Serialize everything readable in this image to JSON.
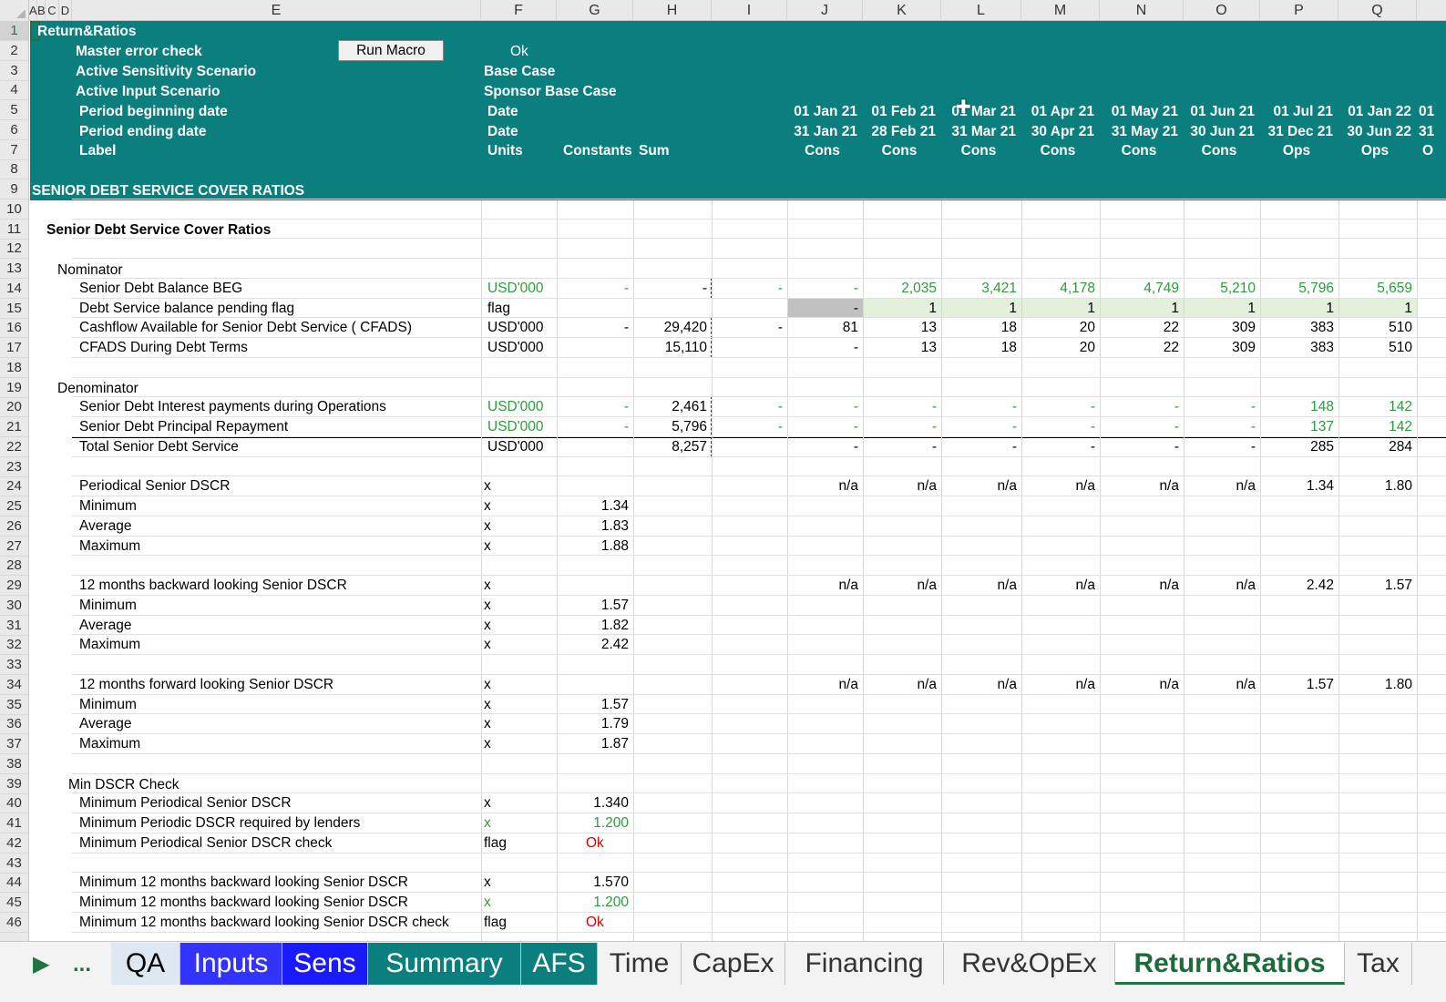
{
  "sheet": {
    "columns": [
      "A",
      "B",
      "C",
      "D",
      "E",
      "F",
      "G",
      "H",
      "I",
      "J",
      "K",
      "L",
      "M",
      "N",
      "O",
      "P",
      "Q"
    ],
    "rows": [
      "1",
      "2",
      "3",
      "4",
      "5",
      "6",
      "7",
      "8",
      "9",
      "10",
      "11",
      "12",
      "13",
      "14",
      "15",
      "16",
      "17",
      "18",
      "19",
      "20",
      "21",
      "22",
      "23",
      "24",
      "25",
      "26",
      "27",
      "28",
      "29",
      "30",
      "31",
      "32",
      "33",
      "34",
      "35",
      "36",
      "37",
      "38",
      "39",
      "40",
      "41",
      "42",
      "43",
      "44",
      "45",
      "46"
    ]
  },
  "header": {
    "title": "Return&Ratios",
    "master_error_check": "Master error check",
    "run_macro": "Run Macro",
    "ok_status": "Ok",
    "active_sensitivity": "Active Sensitivity Scenario",
    "active_sensitivity_value": "Base Case",
    "active_input": "Active Input Scenario",
    "active_input_value": "Sponsor Base Case",
    "period_beg": "Period beginning date",
    "period_end": "Period ending date",
    "label": "Label",
    "date1": "Date",
    "date2": "Date",
    "units": "Units",
    "constants": "Constants",
    "sum": "Sum",
    "section": "SENIOR DEBT SERVICE COVER RATIOS",
    "periods": [
      {
        "beg": "01 Jan 21",
        "end": "31 Jan 21",
        "phase": "Cons"
      },
      {
        "beg": "01 Feb 21",
        "end": "28 Feb 21",
        "phase": "Cons"
      },
      {
        "beg": "01 Mar 21",
        "end": "31 Mar 21",
        "phase": "Cons"
      },
      {
        "beg": "01 Apr 21",
        "end": "30 Apr 21",
        "phase": "Cons"
      },
      {
        "beg": "01 May 21",
        "end": "31 May 21",
        "phase": "Cons"
      },
      {
        "beg": "01 Jun 21",
        "end": "30 Jun 21",
        "phase": "Cons"
      },
      {
        "beg": "01 Jul 21",
        "end": "31 Dec 21",
        "phase": "Ops"
      },
      {
        "beg": "01 Jan 22",
        "end": "30 Jun 22",
        "phase": "Ops"
      }
    ],
    "period_overflow": {
      "beg": "01",
      "end": "31",
      "phase": "O"
    }
  },
  "body": {
    "title": "Senior Debt Service Cover Ratios",
    "nominator": "Nominator",
    "denominator": "Denominator",
    "rows": [
      {
        "label": "Senior Debt  Balance BEG",
        "unit": "USD'000",
        "unit_green": true,
        "g": "-",
        "g_green": true,
        "h": "-",
        "i": "-",
        "i_green": true,
        "vals": [
          "-",
          "2,035",
          "3,421",
          "4,178",
          "4,749",
          "5,210",
          "5,796",
          "5,659"
        ],
        "green": true
      },
      {
        "label": "Debt Service balance pending flag",
        "unit": "flag",
        "g": "",
        "h": "",
        "i": "",
        "vals": [
          "-",
          "1",
          "1",
          "1",
          "1",
          "1",
          "1",
          "1"
        ]
      },
      {
        "label": "Cashflow Available for Senior Debt Service ( CFADS)",
        "unit": "USD'000",
        "g": "-",
        "h": "29,420",
        "i": "-",
        "vals": [
          "81",
          "13",
          "18",
          "20",
          "22",
          "309",
          "383",
          "510"
        ]
      },
      {
        "label": "CFADS During Debt Terms",
        "unit": "USD'000",
        "g": "",
        "h": "15,110",
        "i": "",
        "vals": [
          "-",
          "13",
          "18",
          "20",
          "22",
          "309",
          "383",
          "510"
        ]
      },
      {
        "label": "Senior Debt  Interest payments during Operations",
        "unit": "USD'000",
        "unit_green": true,
        "g": "-",
        "g_green": true,
        "h": "2,461",
        "i": "-",
        "i_green": true,
        "vals": [
          "-",
          "-",
          "-",
          "-",
          "-",
          "-",
          "148",
          "142"
        ],
        "green": true
      },
      {
        "label": "Senior Debt  Principal Repayment",
        "unit": "USD'000",
        "unit_green": true,
        "g": "-",
        "g_green": true,
        "h": "5,796",
        "i": "-",
        "i_green": true,
        "vals": [
          "-",
          "-",
          "-",
          "-",
          "-",
          "-",
          "137",
          "142"
        ],
        "green": true
      },
      {
        "label": "Total Senior Debt Service",
        "unit": "USD'000",
        "g": "",
        "h": "8,257",
        "i": "",
        "vals": [
          "-",
          "-",
          "-",
          "-",
          "-",
          "-",
          "285",
          "284"
        ]
      }
    ],
    "ratio_blocks": [
      {
        "label": "Periodical Senior DSCR",
        "unit": "x",
        "vals": [
          "n/a",
          "n/a",
          "n/a",
          "n/a",
          "n/a",
          "n/a",
          "1.34",
          "1.80"
        ],
        "stats": [
          {
            "label": "Minimum",
            "unit": "x",
            "value": "1.34"
          },
          {
            "label": "Average",
            "unit": "x",
            "value": "1.83"
          },
          {
            "label": "Maximum",
            "unit": "x",
            "value": "1.88"
          }
        ]
      },
      {
        "label": "12 months backward looking Senior DSCR",
        "unit": "x",
        "vals": [
          "n/a",
          "n/a",
          "n/a",
          "n/a",
          "n/a",
          "n/a",
          "2.42",
          "1.57"
        ],
        "stats": [
          {
            "label": "Minimum",
            "unit": "x",
            "value": "1.57"
          },
          {
            "label": "Average",
            "unit": "x",
            "value": "1.82"
          },
          {
            "label": "Maximum",
            "unit": "x",
            "value": "2.42"
          }
        ]
      },
      {
        "label": "12 months forward looking Senior DSCR",
        "unit": "x",
        "vals": [
          "n/a",
          "n/a",
          "n/a",
          "n/a",
          "n/a",
          "n/a",
          "1.57",
          "1.80"
        ],
        "stats": [
          {
            "label": "Minimum",
            "unit": "x",
            "value": "1.57"
          },
          {
            "label": "Average",
            "unit": "x",
            "value": "1.79"
          },
          {
            "label": "Maximum",
            "unit": "x",
            "value": "1.87"
          }
        ]
      }
    ],
    "min_check_title": "Min DSCR Check",
    "checks": [
      {
        "label": "Minimum  Periodical Senior DSCR",
        "unit": "x",
        "value": "1.340",
        "style": "normal"
      },
      {
        "label": "Minimum Periodic DSCR required by lenders",
        "unit": "x",
        "value": "1.200",
        "style": "green"
      },
      {
        "label": "Minimum  Periodical Senior DSCR check",
        "unit": "flag",
        "value": "Ok",
        "style": "red"
      },
      {
        "label": "",
        "unit": "",
        "value": "",
        "style": "normal"
      },
      {
        "label": "Minimum  12 months backward looking Senior DSCR",
        "unit": "x",
        "value": "1.570",
        "style": "normal"
      },
      {
        "label": "Minimum 12 months backward looking Senior DSCR",
        "unit": "x",
        "value": "1.200",
        "style": "green"
      },
      {
        "label": "Minimum  12 months backward looking Senior DSCR check",
        "unit": "flag",
        "value": "Ok",
        "style": "red"
      }
    ]
  },
  "tabs": {
    "nav_next": "▶",
    "nav_more": "...",
    "items": [
      {
        "label": "QA",
        "bg": "#dde8f3",
        "fg": "#000000"
      },
      {
        "label": "Inputs",
        "bg": "#3333ff",
        "fg": "#ffffff"
      },
      {
        "label": "Sens",
        "bg": "#1a1aff",
        "fg": "#ffffff"
      },
      {
        "label": "Summary",
        "bg": "#0b7f7e",
        "fg": "#ffffff"
      },
      {
        "label": "AFS",
        "bg": "#0b7f7e",
        "fg": "#ffffff"
      },
      {
        "label": "Time",
        "bg": "#f3f3f3",
        "fg": "#333333"
      },
      {
        "label": "CapEx",
        "bg": "#f3f3f3",
        "fg": "#333333"
      },
      {
        "label": "Financing",
        "bg": "#f3f3f3",
        "fg": "#333333"
      },
      {
        "label": "Rev&OpEx",
        "bg": "#f3f3f3",
        "fg": "#333333"
      },
      {
        "label": "Return&Ratios",
        "bg": "#ffffff",
        "fg": "#1e6b3a",
        "active": true
      },
      {
        "label": "Tax",
        "bg": "#f3f3f3",
        "fg": "#333333"
      }
    ]
  }
}
